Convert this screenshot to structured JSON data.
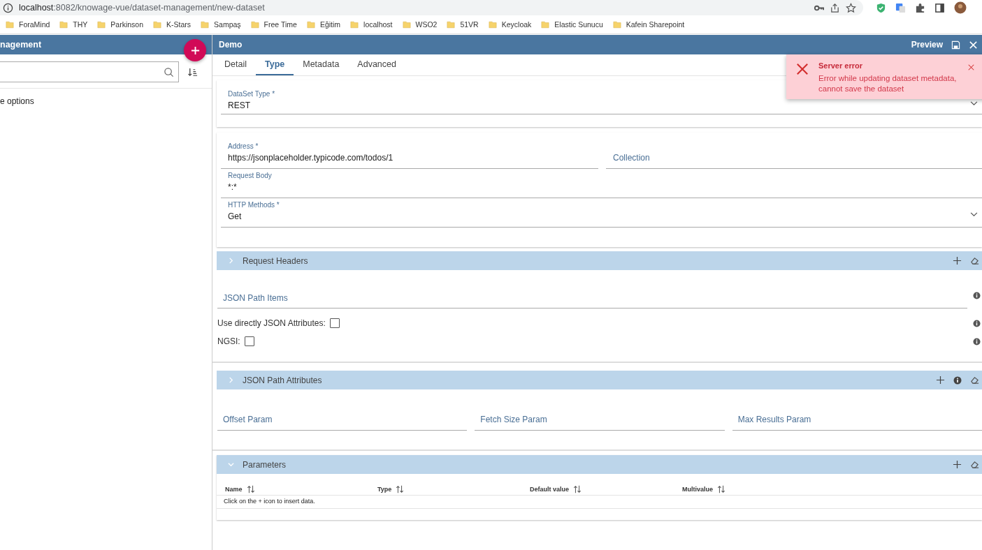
{
  "browser": {
    "url_host": "localhost",
    "url_path": ":8082/knowage-vue/dataset-management/new-dataset",
    "bookmarks": [
      "ForaMind",
      "THY",
      "Parkinson",
      "K-Stars",
      "Sampaş",
      "Free Time",
      "Eğitim",
      "localhost",
      "WSO2",
      "51VR",
      "Keycloak",
      "Elastic Sunucu",
      "Kafein Sharepoint"
    ]
  },
  "sidebar": {
    "title": "nagement",
    "list_text": "e options"
  },
  "detail": {
    "title": "Demo",
    "preview": "Preview",
    "tabs": [
      {
        "label": "Detail",
        "selected": false
      },
      {
        "label": "Type",
        "selected": true
      },
      {
        "label": "Metadata",
        "selected": false
      },
      {
        "label": "Advanced",
        "selected": false
      }
    ],
    "dataset_type": {
      "label": "DataSet Type *",
      "value": "REST"
    },
    "address": {
      "label": "Address *",
      "value": "https://jsonplaceholder.typicode.com/todos/1"
    },
    "collection": {
      "placeholder": "Collection"
    },
    "request_body": {
      "label": "Request Body",
      "value": "*:*"
    },
    "http_methods": {
      "label": "HTTP Methods *",
      "value": "Get"
    },
    "request_headers": {
      "title": "Request Headers",
      "expanded": false
    },
    "json_path_items": {
      "placeholder": "JSON Path Items"
    },
    "checkboxes": [
      {
        "label": "Use directly JSON Attributes:",
        "checked": false
      },
      {
        "label": "NGSI:",
        "checked": false
      }
    ],
    "json_path_attributes": {
      "title": "JSON Path Attributes",
      "expanded": false
    },
    "params": [
      {
        "placeholder": "Offset Param"
      },
      {
        "placeholder": "Fetch Size Param"
      },
      {
        "placeholder": "Max Results Param"
      }
    ],
    "parameters": {
      "title": "Parameters",
      "expanded": true,
      "columns": [
        "Name",
        "Type",
        "Default value",
        "Multivalue"
      ],
      "empty_message": "Click on the + icon to insert data."
    }
  },
  "toast": {
    "title": "Server error",
    "message": "Error while updating dataset metadata, cannot save the dataset"
  }
}
